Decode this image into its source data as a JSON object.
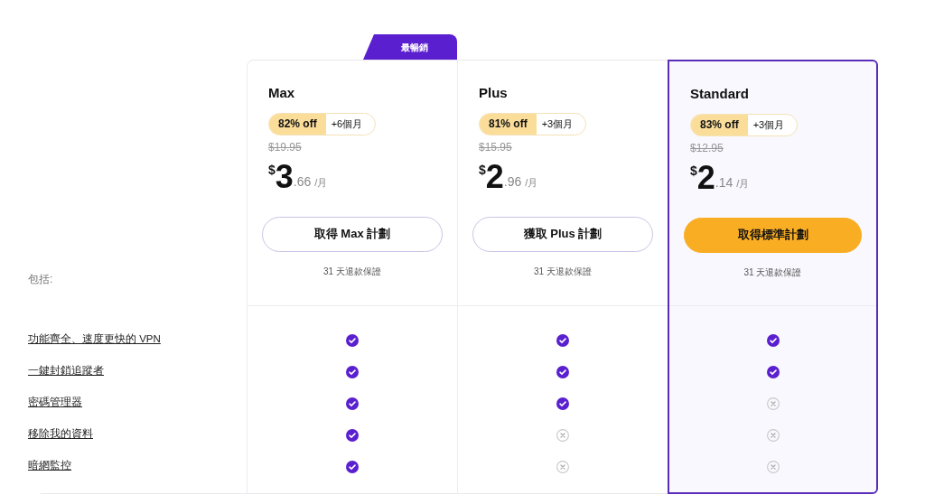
{
  "includes_label": "包括:",
  "features": [
    "功能齊全、速度更快的 VPN",
    "一鍵封鎖追蹤者",
    "密碼管理器",
    "移除我的資料",
    "暗網監控"
  ],
  "plans": [
    {
      "badge": "最暢銷",
      "name": "Max",
      "discount": "82% off",
      "bonus": "+6個月",
      "original_price": "$19.95",
      "currency": "$",
      "price_major": "3",
      "price_minor": ".66",
      "per": "/月",
      "button": "取得 Max 計劃",
      "guarantee": "31 天退款保證",
      "selected": false,
      "included": [
        true,
        true,
        true,
        true,
        true
      ]
    },
    {
      "name": "Plus",
      "discount": "81% off",
      "bonus": "+3個月",
      "original_price": "$15.95",
      "currency": "$",
      "price_major": "2",
      "price_minor": ".96",
      "per": "/月",
      "button": "獲取 Plus 計劃",
      "guarantee": "31 天退款保證",
      "selected": false,
      "included": [
        true,
        true,
        true,
        false,
        false
      ]
    },
    {
      "name": "Standard",
      "discount": "83% off",
      "bonus": "+3個月",
      "original_price": "$12.95",
      "currency": "$",
      "price_major": "2",
      "price_minor": ".14",
      "per": "/月",
      "button": "取得標準計劃",
      "guarantee": "31 天退款保證",
      "selected": true,
      "included": [
        true,
        true,
        false,
        false,
        false
      ]
    }
  ]
}
